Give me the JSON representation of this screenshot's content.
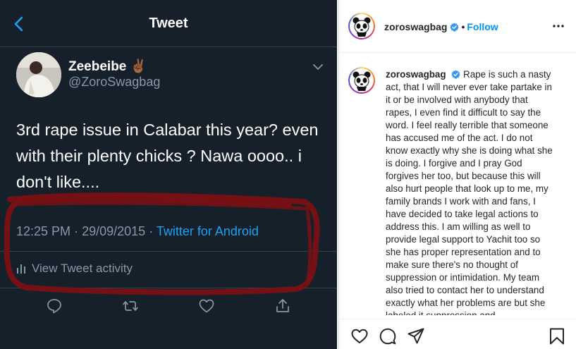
{
  "twitter": {
    "header_title": "Tweet",
    "user": {
      "name": "Zeebeibe",
      "emoji": "✌🏾",
      "handle": "@ZoroSwagbag"
    },
    "tweet_text": "3rd rape issue in Calabar this year? even with their plenty chicks ? Nawa oooo.. i don't like....",
    "meta": {
      "time": "12:25 PM",
      "separator": "·",
      "date": "29/09/2015",
      "source": "Twitter for Android"
    },
    "activity_label": "View Tweet activity",
    "icons": [
      "back-arrow-icon",
      "chevron-down-icon",
      "reply-icon",
      "retweet-icon",
      "like-icon",
      "share-icon",
      "bar-chart-icon"
    ],
    "colors": {
      "background": "#15202b",
      "accent": "#1da1f2",
      "muted": "#8899a6",
      "markup": "#7a1014"
    }
  },
  "instagram": {
    "header": {
      "username": "zoroswagbag",
      "dot": "•",
      "follow_label": "Follow"
    },
    "caption": {
      "username": "zoroswagbag",
      "text": "Rape is such a nasty act, that I will never ever take partake in it or be involved with anybody that rapes, I even find it difficult to say the word. I feel really terrible that someone has accused me of the act. I do not know exactly why she is doing what she is doing. I forgive and I pray God forgives her too, but because this will also hurt people that look up to me, my family brands I work with and fans, I have decided to take legal actions to address this. I am willing as well to provide legal support to Yachit too so she has proper representation and to make sure there's no thought of suppression or intimidation. My team also tried to contact her to understand exactly what her problems are but she labeled it suppression and"
    },
    "icons": [
      "panda-avatar-icon",
      "verified-badge-icon",
      "more-options-icon",
      "heart-icon",
      "comment-icon",
      "send-icon",
      "bookmark-icon"
    ],
    "colors": {
      "follow": "#0095f6",
      "verified": "#3897f0",
      "text": "#262626"
    }
  }
}
